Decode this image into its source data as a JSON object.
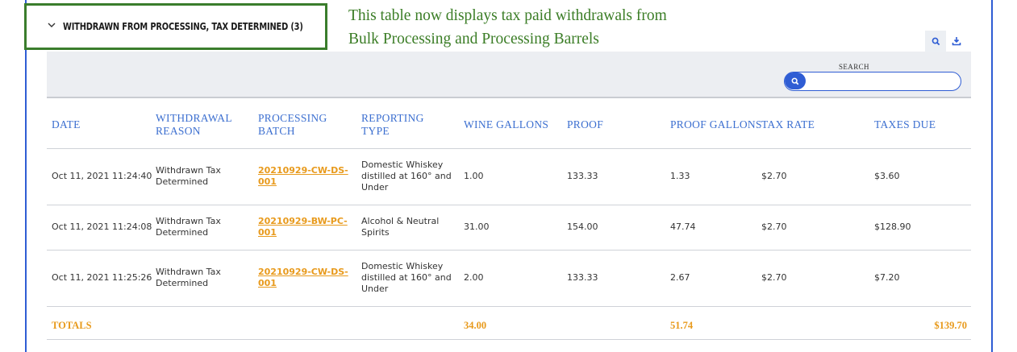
{
  "section": {
    "title": "WITHDRAWN FROM PROCESSING, TAX DETERMINED (3)"
  },
  "annotation": {
    "line1": "This table now displays tax paid withdrawals from",
    "line2": "Bulk Processing and Processing Barrels"
  },
  "toolbar": {
    "search_icon": "search-icon",
    "download_icon": "download-icon"
  },
  "search": {
    "label": "SEARCH",
    "value": "",
    "placeholder": ""
  },
  "columns": [
    "DATE",
    "WITHDRAWAL REASON",
    "PROCESSING BATCH",
    "REPORTING TYPE",
    "WINE GALLONS",
    "PROOF",
    "PROOF GALLONS",
    "TAX RATE",
    "TAXES DUE"
  ],
  "column_lines": [
    [
      "DATE"
    ],
    [
      "WITHDRAWAL",
      "REASON"
    ],
    [
      "PROCESSING",
      "BATCH"
    ],
    [
      "REPORTING",
      "TYPE"
    ],
    [
      "WINE GALLONS"
    ],
    [
      "PROOF"
    ],
    [
      "PROOF GALLONS"
    ],
    [
      "TAX RATE"
    ],
    [
      "TAXES DUE"
    ]
  ],
  "rows": [
    {
      "date": "Oct 11, 2021 11:24:40",
      "reason": [
        "Withdrawn Tax",
        "Determined"
      ],
      "batch": [
        "20210929-CW-DS-",
        "001"
      ],
      "type": [
        "Domestic Whiskey",
        "distilled at 160° and",
        "Under"
      ],
      "wine_gallons": "1.00",
      "proof": "133.33",
      "proof_gallons": "1.33",
      "tax_rate": "$2.70",
      "taxes_due": "$3.60"
    },
    {
      "date": "Oct 11, 2021 11:24:08",
      "reason": [
        "Withdrawn Tax",
        "Determined"
      ],
      "batch": [
        "20210929-BW-PC-",
        "001"
      ],
      "type": [
        "Alcohol & Neutral",
        "Spirits"
      ],
      "wine_gallons": "31.00",
      "proof": "154.00",
      "proof_gallons": "47.74",
      "tax_rate": "$2.70",
      "taxes_due": "$128.90"
    },
    {
      "date": "Oct 11, 2021 11:25:26",
      "reason": [
        "Withdrawn Tax",
        "Determined"
      ],
      "batch": [
        "20210929-CW-DS-",
        "001"
      ],
      "type": [
        "Domestic Whiskey",
        "distilled at 160° and",
        "Under"
      ],
      "wine_gallons": "2.00",
      "proof": "133.33",
      "proof_gallons": "2.67",
      "tax_rate": "$2.70",
      "taxes_due": "$7.20"
    }
  ],
  "totals": {
    "label": "TOTALS",
    "wine_gallons": "34.00",
    "proof_gallons": "51.74",
    "taxes_due": "$139.70"
  },
  "colors": {
    "accent_blue": "#2f5dd4",
    "header_blue": "#3c6fd0",
    "link_orange": "#e89a1c",
    "annotation_green": "#3b7d26"
  }
}
